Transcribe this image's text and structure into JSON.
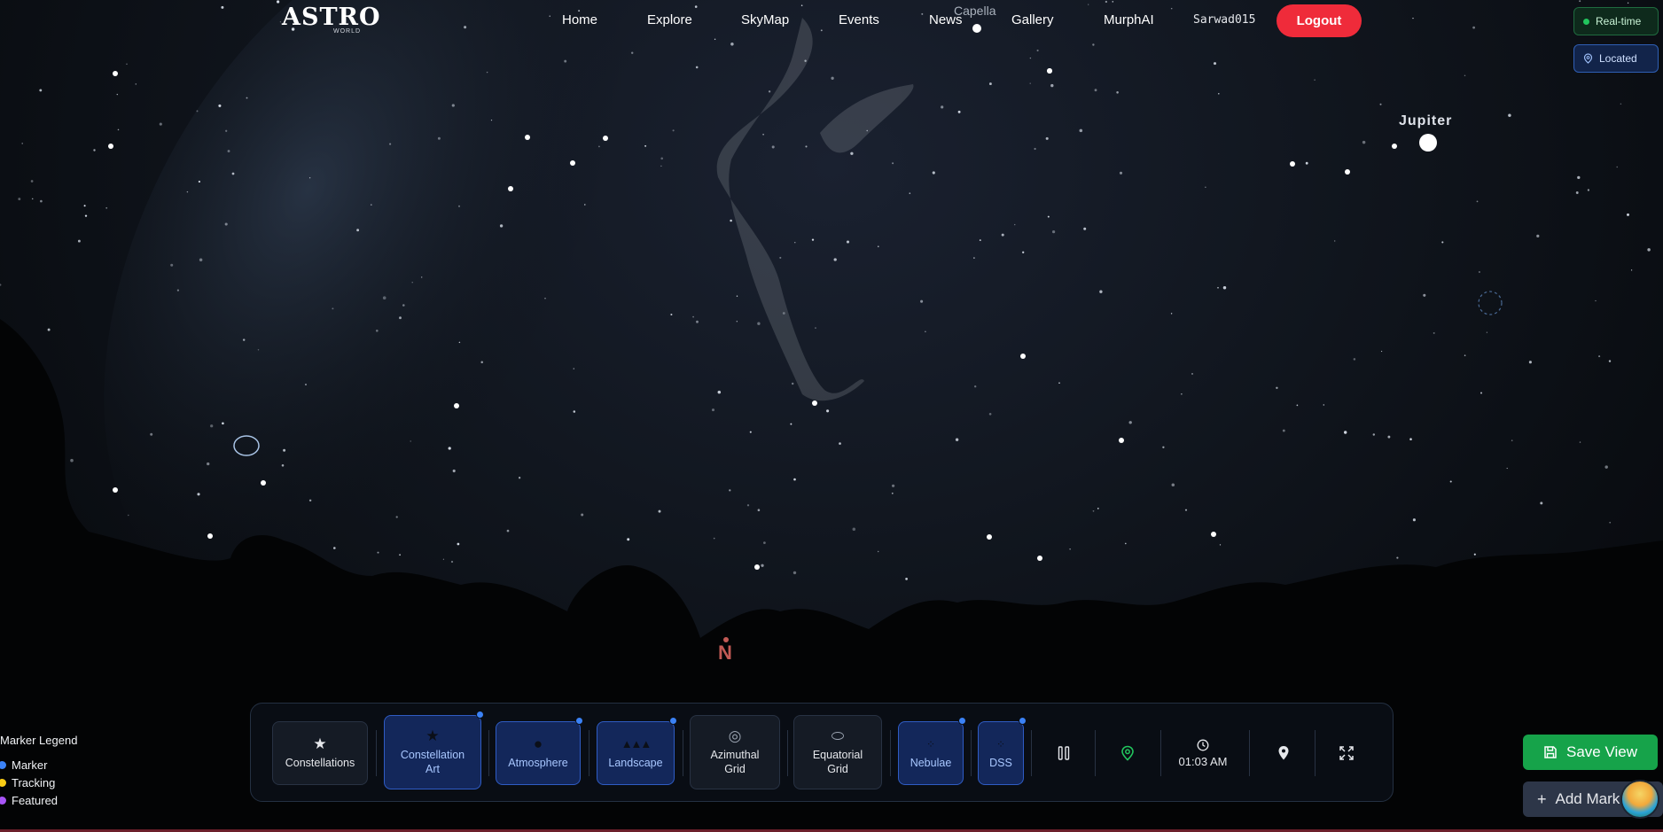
{
  "nav": {
    "logo": "ASTRO",
    "logo_sub": "WORLD",
    "links": [
      "Home",
      "Explore",
      "SkyMap",
      "Events",
      "News",
      "Gallery",
      "MurphAI"
    ],
    "username": "Sarwad015",
    "logout": "Logout"
  },
  "status": {
    "realtime": "Real-time",
    "located": "Located"
  },
  "sky": {
    "capella": "Capella",
    "jupiter": "Jupiter",
    "north": "N"
  },
  "toolbar": {
    "constellations": "Constellations",
    "constellation_art": "Constellation Art",
    "atmosphere": "Atmosphere",
    "landscape": "Landscape",
    "azimuthal_grid": "Azimuthal Grid",
    "equatorial_grid": "Equatorial Grid",
    "nebulae": "Nebulae",
    "dss": "DSS",
    "time": "01:03 AM"
  },
  "legend": {
    "title": "Marker Legend",
    "items": [
      {
        "label": "Marker",
        "color": "#3b82f6"
      },
      {
        "label": "Tracking",
        "color": "#facc15"
      },
      {
        "label": "Featured",
        "color": "#a855f7"
      }
    ]
  },
  "actions": {
    "save_view": "Save View",
    "add_marker": "Add Mark"
  },
  "icons": {
    "pause": "pause-icon",
    "location": "location-pin-icon",
    "clock": "clock-icon",
    "marker": "map-pin-icon",
    "fullscreen": "fullscreen-icon"
  }
}
